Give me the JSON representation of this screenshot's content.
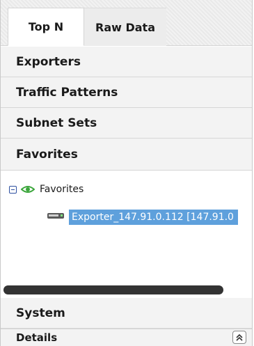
{
  "tabs": [
    {
      "label": "Top N"
    },
    {
      "label": "Raw Data"
    }
  ],
  "sections": {
    "exporters": "Exporters",
    "traffic_patterns": "Traffic Patterns",
    "subnet_sets": "Subnet Sets",
    "favorites": "Favorites",
    "system": "System",
    "details": "Details"
  },
  "tree": {
    "root_label": "Favorites",
    "child_label": "Exporter_147.91.0.112 [147.91.0"
  },
  "icons": {
    "toggle": "collapse-minus-icon",
    "root": "eye-icon",
    "child": "server-icon",
    "details_button": "double-chevron-up-icon"
  },
  "colors": {
    "selection": "#5ea0dc",
    "eye": "#3aa53a"
  }
}
